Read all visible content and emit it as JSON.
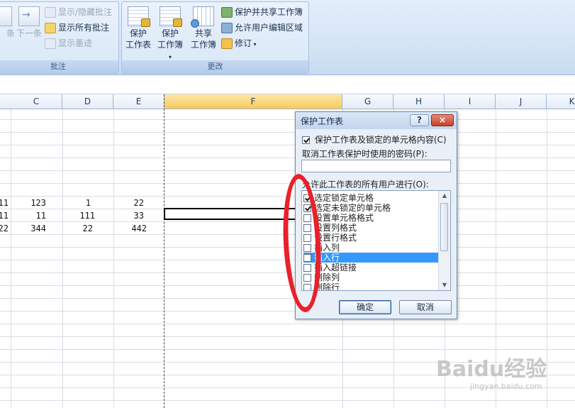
{
  "ribbon": {
    "comments_group": {
      "prev_label": "条",
      "next_label": "下一条",
      "show_hide_label": "显示/隐藏批注",
      "show_all_label": "显示所有批注",
      "show_ink_label": "显示墨迹",
      "group_label": "批注"
    },
    "changes_group": {
      "protect_sheet_label_1": "保护",
      "protect_sheet_label_2": "工作表",
      "protect_workbook_label_1": "保护",
      "protect_workbook_label_2": "工作簿",
      "share_workbook_label_1": "共享",
      "share_workbook_label_2": "工作簿",
      "protect_share_label": "保护并共享工作簿",
      "allow_edit_ranges_label": "允许用户编辑区域",
      "track_changes_label": "修订",
      "group_label": "更改"
    }
  },
  "columns": [
    "C",
    "D",
    "E",
    "F",
    "G",
    "H",
    "I",
    "J",
    "K"
  ],
  "selected_column": "F",
  "cells": {
    "row1": {
      "B": "11",
      "C": "123",
      "D": "1",
      "E": "22"
    },
    "row2": {
      "B": "11",
      "C": "11",
      "D": "111",
      "E": "33"
    },
    "row3": {
      "B": "22",
      "C": "344",
      "D": "22",
      "E": "442"
    }
  },
  "dialog": {
    "title": "保护工作表",
    "help_glyph": "?",
    "close_glyph": "×",
    "protect_label": "保护工作表及锁定的单元格内容(C)",
    "password_label": "取消工作表保护时使用的密码(P):",
    "password_value": "",
    "allow_label": "允许此工作表的所有用户进行(O):",
    "permissions": [
      {
        "label": "选定锁定单元格",
        "checked": true,
        "selected": false
      },
      {
        "label": "选定未锁定的单元格",
        "checked": true,
        "selected": false
      },
      {
        "label": "设置单元格格式",
        "checked": false,
        "selected": false
      },
      {
        "label": "设置列格式",
        "checked": false,
        "selected": false
      },
      {
        "label": "设置行格式",
        "checked": false,
        "selected": false
      },
      {
        "label": "插入列",
        "checked": false,
        "selected": false
      },
      {
        "label": "插入行",
        "checked": false,
        "selected": true
      },
      {
        "label": "插入超链接",
        "checked": false,
        "selected": false
      },
      {
        "label": "删除列",
        "checked": false,
        "selected": false
      },
      {
        "label": "删除行",
        "checked": false,
        "selected": false
      }
    ],
    "ok_label": "确定",
    "cancel_label": "取消"
  },
  "watermark": {
    "text": "Baidu经验",
    "sub": "jingyan.baidu.com"
  },
  "colors": {
    "annotation": "#e8212a",
    "selection": "#3399ff",
    "column_highlight": "#f8c95b"
  }
}
